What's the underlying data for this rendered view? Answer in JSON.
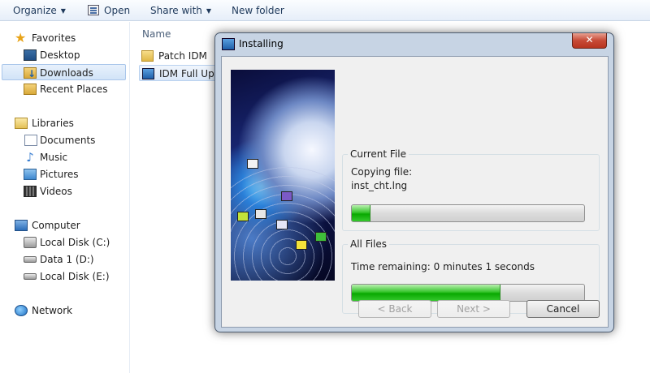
{
  "toolbar": {
    "organize": "Organize",
    "open": "Open",
    "share_with": "Share with",
    "new_folder": "New folder"
  },
  "nav": {
    "favorites": "Favorites",
    "desktop": "Desktop",
    "downloads": "Downloads",
    "recent_places": "Recent Places",
    "libraries": "Libraries",
    "documents": "Documents",
    "music": "Music",
    "pictures": "Pictures",
    "videos": "Videos",
    "computer": "Computer",
    "local_disk_c": "Local Disk (C:)",
    "data1_d": "Data 1  (D:)",
    "local_disk_e": "Local Disk (E:)",
    "network": "Network"
  },
  "filelist": {
    "column_name": "Name",
    "files": [
      "Patch IDM",
      "IDM Full Upd"
    ]
  },
  "dialog": {
    "title": "Installing",
    "close_label": "✕",
    "current_file": {
      "caption": "Current File",
      "line1": "Copying file:",
      "line2": "inst_cht.lng",
      "progress": 0.08
    },
    "all_files": {
      "caption": "All Files",
      "time_remaining": "Time remaining: 0 minutes 1 seconds",
      "progress": 0.64
    },
    "buttons": {
      "back": "< Back",
      "next": "Next >",
      "cancel": "Cancel"
    }
  },
  "colors": {
    "progress_green": "#08a800",
    "close_red": "#c74a36"
  }
}
